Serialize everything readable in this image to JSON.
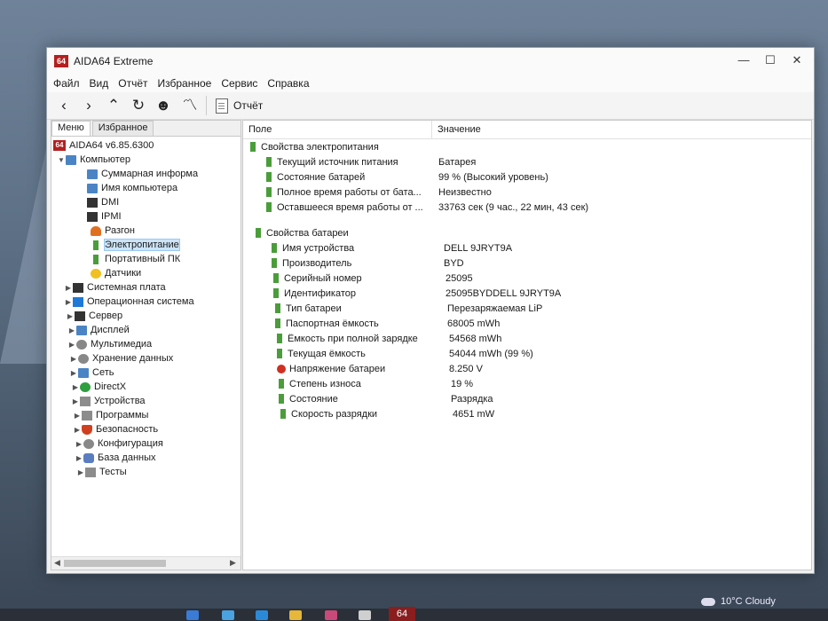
{
  "window": {
    "title": "AIDA64 Extreme",
    "logo": "64"
  },
  "controls": {
    "minimize": "—",
    "maximize": "☐",
    "close": "✕"
  },
  "menu": [
    "Файл",
    "Вид",
    "Отчёт",
    "Избранное",
    "Сервис",
    "Справка"
  ],
  "toolbar": {
    "back_icon": "‹",
    "forward_icon": "›",
    "up_icon": "⌃",
    "refresh_icon": "↻",
    "user_icon": "☻",
    "chart_icon": "〽",
    "report_label": "Отчёт"
  },
  "tabs": [
    "Меню",
    "Избранное"
  ],
  "tree": {
    "root": "AIDA64 v6.85.6300",
    "computer": "Компьютер",
    "computer_children": [
      "Суммарная информа",
      "Имя компьютера",
      "DMI",
      "IPMI",
      "Разгон",
      "Электропитание",
      "Портативный ПК",
      "Датчики"
    ],
    "groups": [
      "Системная плата",
      "Операционная система",
      "Сервер",
      "Дисплей",
      "Мультимедиа",
      "Хранение данных",
      "Сеть",
      "DirectX",
      "Устройства",
      "Программы",
      "Безопасность",
      "Конфигурация",
      "База данных",
      "Тесты"
    ]
  },
  "grid": {
    "col_field": "Поле",
    "col_value": "Значение",
    "section1": "Свойства электропитания",
    "rows1": [
      {
        "field": "Текущий источник питания",
        "value": "Батарея"
      },
      {
        "field": "Состояние батарей",
        "value": "99 % (Высокий уровень)"
      },
      {
        "field": "Полное время работы от бата...",
        "value": "Неизвестно"
      },
      {
        "field": "Оставшееся время работы от ...",
        "value": "33763 сек (9 час., 22 мин, 43 сек)"
      }
    ],
    "section2": "Свойства батареи",
    "rows2": [
      {
        "field": "Имя устройства",
        "value": "DELL 9JRYT9A"
      },
      {
        "field": "Производитель",
        "value": "BYD"
      },
      {
        "field": "Серийный номер",
        "value": "25095"
      },
      {
        "field": "Идентификатор",
        "value": "25095BYDDELL 9JRYT9A"
      },
      {
        "field": "Тип батареи",
        "value": "Перезаряжаемая LiP"
      },
      {
        "field": "Паспортная ёмкость",
        "value": "68005 mWh"
      },
      {
        "field": "Ёмкость при полной зарядке",
        "value": "54568 mWh"
      },
      {
        "field": "Текущая ёмкость",
        "value": "54044 mWh  (99 %)"
      },
      {
        "field": "Напряжение батареи",
        "value": "8.250 V"
      },
      {
        "field": "Степень износа",
        "value": "19 %"
      },
      {
        "field": "Состояние",
        "value": "Разрядка"
      },
      {
        "field": "Скорость разрядки",
        "value": "4651 mW"
      }
    ]
  },
  "taskbar": {
    "weather": "10°C  Cloudy",
    "aida_badge": "64"
  }
}
